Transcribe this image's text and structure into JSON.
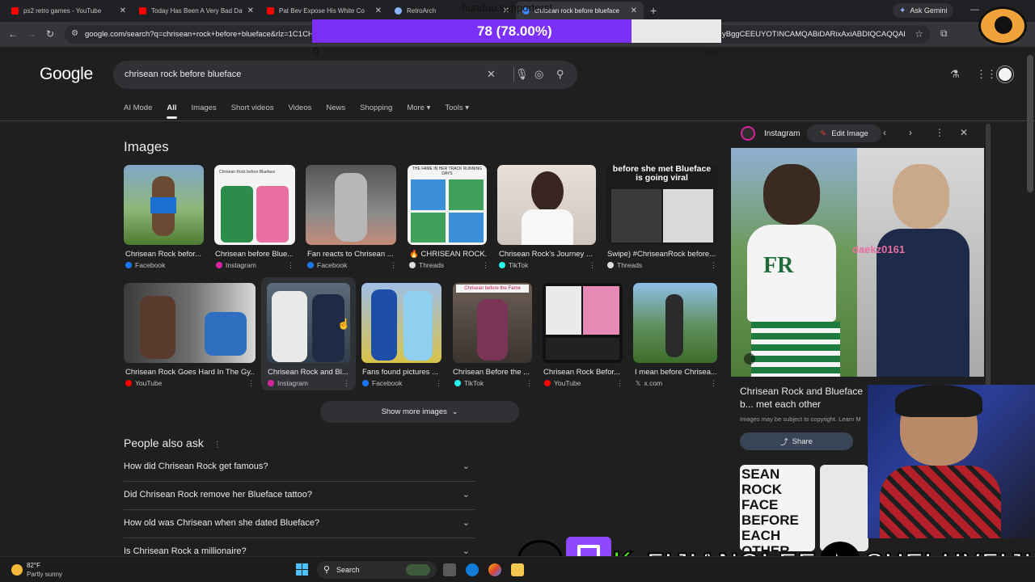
{
  "tabs": [
    {
      "title": "ps2 retro games - YouTube",
      "type": "youtube"
    },
    {
      "title": "Today Has Been A Very Bad Day",
      "type": "youtube"
    },
    {
      "title": "Pat Bev Expose His White Co",
      "type": "youtube"
    },
    {
      "title": "RetroArch",
      "type": "globe"
    },
    {
      "title": "chrisean rock before blueface",
      "type": "google",
      "active": true
    }
  ],
  "browser": {
    "gemini_label": "Ask Gemini",
    "url": "google.com/search?q=chrisean+rock+before+blueface&rlz=1C1CHB",
    "url_tail": "yBggCEEUYOTINCAMQABiDARixAxiABDIQCAQQABiD..."
  },
  "google": {
    "logo": "Google",
    "query": "chrisean rock before blueface",
    "filters": [
      "AI Mode",
      "All",
      "Images",
      "Short videos",
      "Videos",
      "News",
      "Shopping",
      "More",
      "Tools"
    ],
    "active_filter": "All",
    "images_title": "Images",
    "image_row1": [
      {
        "label": "Chrisean Rock befor...",
        "source": "Facebook"
      },
      {
        "label": "Chrisean before Blue...",
        "source": "Instagram"
      },
      {
        "label": "Fan reacts to Chrisean ...",
        "source": "Facebook"
      },
      {
        "label": "CHRISEAN ROCK...",
        "source": "Threads"
      },
      {
        "label": "Chrisean Rock's Journey ...",
        "source": "TikTok"
      },
      {
        "label": "Swipe) #ChriseanRock before...",
        "source": "Threads"
      }
    ],
    "image_row2": [
      {
        "label": "Chrisean Rock Goes Hard In The Gy...",
        "source": "YouTube"
      },
      {
        "label": "Chrisean Rock and Bl...",
        "source": "Instagram"
      },
      {
        "label": "Fans found pictures ...",
        "source": "Facebook"
      },
      {
        "label": "Chrisean Before the ...",
        "source": "TikTok"
      },
      {
        "label": "Chrisean Rock Befor...",
        "source": "YouTube"
      },
      {
        "label": "I mean before Chrisea...",
        "source": "x.com"
      }
    ],
    "thumb_texts": {
      "viral_caption": "before she met Blueface is going viral",
      "fame_caption": "THE FAME IN HER TRACK RUNNING DAYS",
      "nostalgia_caption": "Chrisean Rock before Blueface",
      "before_fame": "Chrisean before the Fame"
    },
    "show_more": "Show more images",
    "paa_title": "People also ask",
    "paa": [
      "How did Chrisean Rock get famous?",
      "Did Chrisean Rock remove her Blueface tattoo?",
      "How old was Chrisean when she dated Blueface?",
      "Is Chrisean Rock a millionaire?"
    ]
  },
  "panel": {
    "source": "Instagram",
    "edit_label": "Edit Image",
    "title": "Chrisean Rock and Blueface b... met each other",
    "copyright": "Images may be subject to copyright. Learn M",
    "share_label": "Share",
    "overlay_user": "daekz0161",
    "related_caption": "SEAN ROCK FACE BEFORE EACH OTHER"
  },
  "overlay": {
    "goal_title": "hunduu supporters!",
    "progress_text": "78 (78.00%)",
    "progress_value": 78,
    "min": "0",
    "max": "100",
    "handles": [
      "FIJIANOLEE",
      "SHELUVFIJI"
    ]
  },
  "taskbar": {
    "temp": "82°F",
    "condition": "Partly sunny",
    "search": "Search"
  },
  "colors": {
    "accent_purple": "#7b2ff7",
    "instagram": "#d6249f",
    "facebook": "#1877f2",
    "youtube": "#ff0000"
  }
}
